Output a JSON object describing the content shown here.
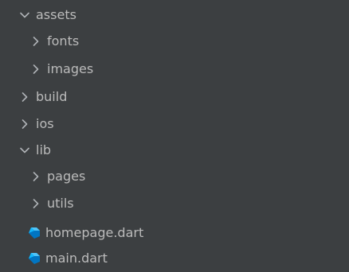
{
  "project_tree": {
    "items": [
      {
        "label": "assets",
        "expanded": true,
        "type": "folder"
      },
      {
        "label": "fonts",
        "expanded": false,
        "type": "folder"
      },
      {
        "label": "images",
        "expanded": false,
        "type": "folder"
      },
      {
        "label": "build",
        "expanded": false,
        "type": "folder"
      },
      {
        "label": "ios",
        "expanded": false,
        "type": "folder"
      },
      {
        "label": "lib",
        "expanded": true,
        "type": "folder"
      },
      {
        "label": "pages",
        "expanded": false,
        "type": "folder"
      },
      {
        "label": "utils",
        "expanded": false,
        "type": "folder"
      },
      {
        "label": "homepage.dart",
        "type": "file",
        "icon": "dart-file-icon"
      },
      {
        "label": "main.dart",
        "type": "file",
        "icon": "dart-file-icon"
      }
    ]
  },
  "colors": {
    "background": "#3c3f41",
    "text": "#bbbbbb",
    "chevron": "#aeb2b6",
    "dart_icon_dark": "#0175c2",
    "dart_icon_light": "#4fc3f7"
  }
}
